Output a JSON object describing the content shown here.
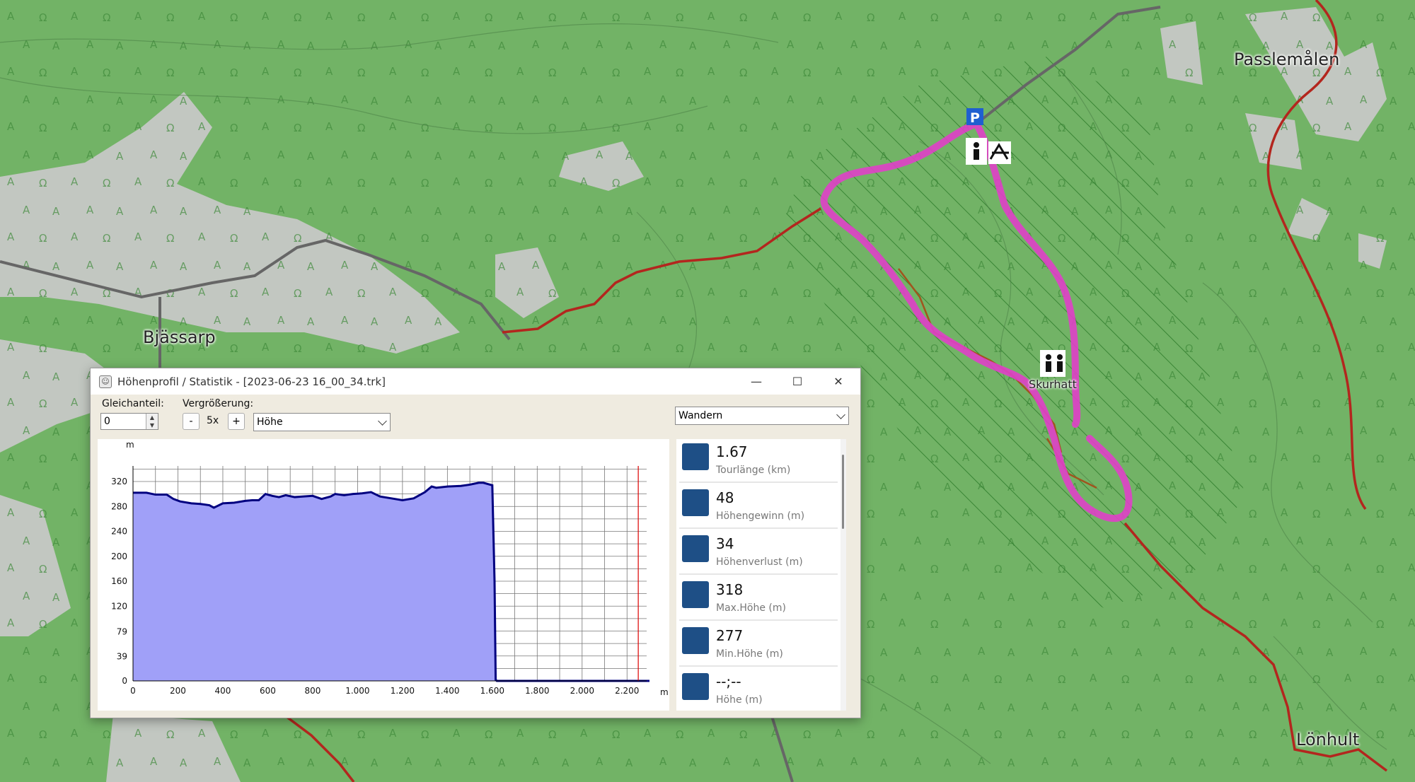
{
  "map": {
    "places": {
      "bjassarp": "Bjässarp",
      "passlemalen": "Passlemålen",
      "lonhult": "Lönhult",
      "skurhatt": "Skurhatt"
    },
    "parking_label": "P"
  },
  "window": {
    "title": "Höhenprofil / Statistik - [2023-06-23 16_00_34.trk]",
    "controls": {
      "minimize": "—",
      "maximize": "☐",
      "close": "✕"
    }
  },
  "toolbar": {
    "gleichanteil_label": "Gleichanteil:",
    "gleichanteil_value": "0",
    "vergroesserung_label": "Vergrößerung:",
    "zoom_minus": "-",
    "zoom_value": "5x",
    "zoom_plus": "+",
    "profile_select": "Höhe",
    "activity_select": "Wandern"
  },
  "stats": [
    {
      "icon": "track-length-icon",
      "value": "1.67",
      "label": "Tourlänge (km)"
    },
    {
      "icon": "elevation-gain-icon",
      "value": "48",
      "label": "Höhengewinn (m)"
    },
    {
      "icon": "elevation-loss-icon",
      "value": "34",
      "label": "Höhenverlust (m)"
    },
    {
      "icon": "max-height-icon",
      "value": "318",
      "label": "Max.Höhe (m)"
    },
    {
      "icon": "min-height-icon",
      "value": "277",
      "label": "Min.Höhe (m)"
    },
    {
      "icon": "height-icon",
      "value": "--;--",
      "label": "Höhe (m)"
    }
  ],
  "chart_data": {
    "type": "area",
    "ylabel": "m",
    "xlabel": "m",
    "yticks": [
      0,
      39,
      79,
      120,
      160,
      200,
      240,
      280,
      320
    ],
    "xticks": [
      "0",
      "200",
      "400",
      "600",
      "800",
      "1.000",
      "1.200",
      "1.400",
      "1.600",
      "1.800",
      "2.000",
      "2.200"
    ],
    "xlim": [
      0,
      2300
    ],
    "ylim": [
      0,
      345
    ],
    "grid": true,
    "fill_color": "#a0a0f8",
    "line_color": "#000080",
    "marker_x": 2250,
    "series": [
      {
        "x": [
          0,
          60,
          100,
          150,
          180,
          210,
          260,
          300,
          340,
          360,
          400,
          450,
          500,
          530,
          560,
          590,
          620,
          650,
          680,
          720,
          760,
          800,
          840,
          880,
          900,
          940,
          980,
          1020,
          1060,
          1100,
          1150,
          1200,
          1250,
          1300,
          1330,
          1350,
          1400,
          1460,
          1500,
          1540,
          1560,
          1580,
          1600,
          1610,
          1615,
          1620,
          1700,
          2300
        ],
        "values": [
          302,
          302,
          299,
          299,
          292,
          288,
          285,
          284,
          282,
          278,
          285,
          286,
          289,
          290,
          290,
          300,
          297,
          295,
          298,
          295,
          296,
          297,
          292,
          296,
          300,
          298,
          300,
          301,
          303,
          296,
          293,
          290,
          293,
          303,
          312,
          310,
          312,
          313,
          315,
          318,
          318,
          316,
          314,
          160,
          2,
          0,
          0,
          0
        ]
      }
    ]
  }
}
